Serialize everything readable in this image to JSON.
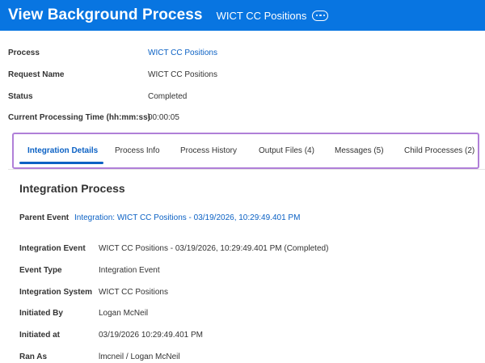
{
  "header": {
    "title": "View Background Process",
    "subtitle": "WICT CC Positions",
    "more_icon": "ellipsis-icon",
    "bg_color": "#0875e1"
  },
  "summary": {
    "process_label": "Process",
    "process_value": "WICT CC Positions",
    "request_name_label": "Request Name",
    "request_name_value": "WICT CC Positions",
    "status_label": "Status",
    "status_value": "Completed",
    "time_label": "Current Processing Time (hh:mm:ss)",
    "time_value": "00:00:05"
  },
  "tabs": [
    {
      "label": "Integration Details",
      "active": true
    },
    {
      "label": "Process Info",
      "active": false
    },
    {
      "label": "Process History",
      "active": false
    },
    {
      "label": "Output Files (4)",
      "active": false
    },
    {
      "label": "Messages (5)",
      "active": false
    },
    {
      "label": "Child Processes (2)",
      "active": false
    }
  ],
  "integration": {
    "section_title": "Integration Process",
    "parent_event_label": "Parent Event",
    "parent_event_value": "Integration: WICT CC Positions - 03/19/2026, 10:29:49.401 PM",
    "integration_event_label": "Integration Event",
    "integration_event_value": "WICT CC Positions - 03/19/2026, 10:29:49.401 PM (Completed)",
    "event_type_label": "Event Type",
    "event_type_value": "Integration Event",
    "integration_system_label": "Integration System",
    "integration_system_value": "WICT CC Positions",
    "initiated_by_label": "Initiated By",
    "initiated_by_value": "Logan McNeil",
    "initiated_at_label": "Initiated at",
    "initiated_at_value": "03/19/2026 10:29:49.401 PM",
    "ran_as_label": "Ran As",
    "ran_as_value": "lmcneil / Logan McNeil"
  },
  "colors": {
    "link": "#0b61c4",
    "highlight_border": "#b07fd8"
  }
}
